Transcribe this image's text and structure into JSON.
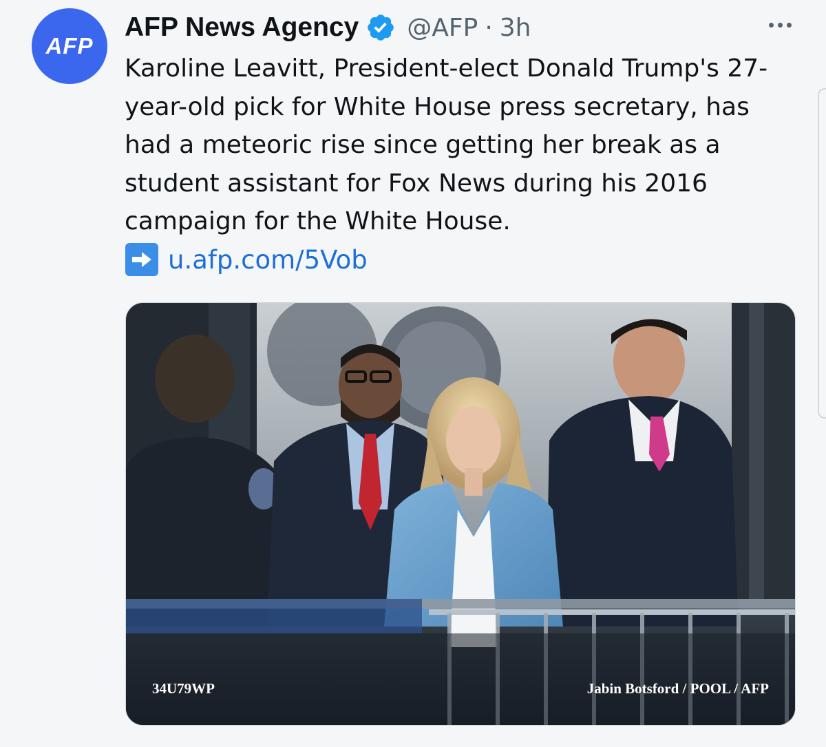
{
  "author": {
    "avatar_text": "AFP",
    "display_name": "AFP News Agency",
    "handle": "@AFP",
    "separator": "·",
    "timestamp": "3h",
    "verified_icon": "verified-badge-icon"
  },
  "tweet": {
    "text_lines": [
      "Karoline Leavitt, President-elect Donald Trump's 27-",
      "year-old pick for White House press secretary, has",
      "had a meteoric rise since getting her break as a",
      "student assistant for Fox News during his 2016",
      "campaign for the White House."
    ],
    "link_icon": "right-arrow-icon",
    "link_text": "u.afp.com/5Vob"
  },
  "media": {
    "photo_id": "34U79WP",
    "photo_credit": "Jabin Botsford / POOL / AFP"
  },
  "colors": {
    "avatar_bg": "#3a67ee",
    "verified": "#1d9bf0",
    "link": "#1d6fd8",
    "muted": "#536471",
    "link_arrow_bg": "#3b8ee5"
  }
}
